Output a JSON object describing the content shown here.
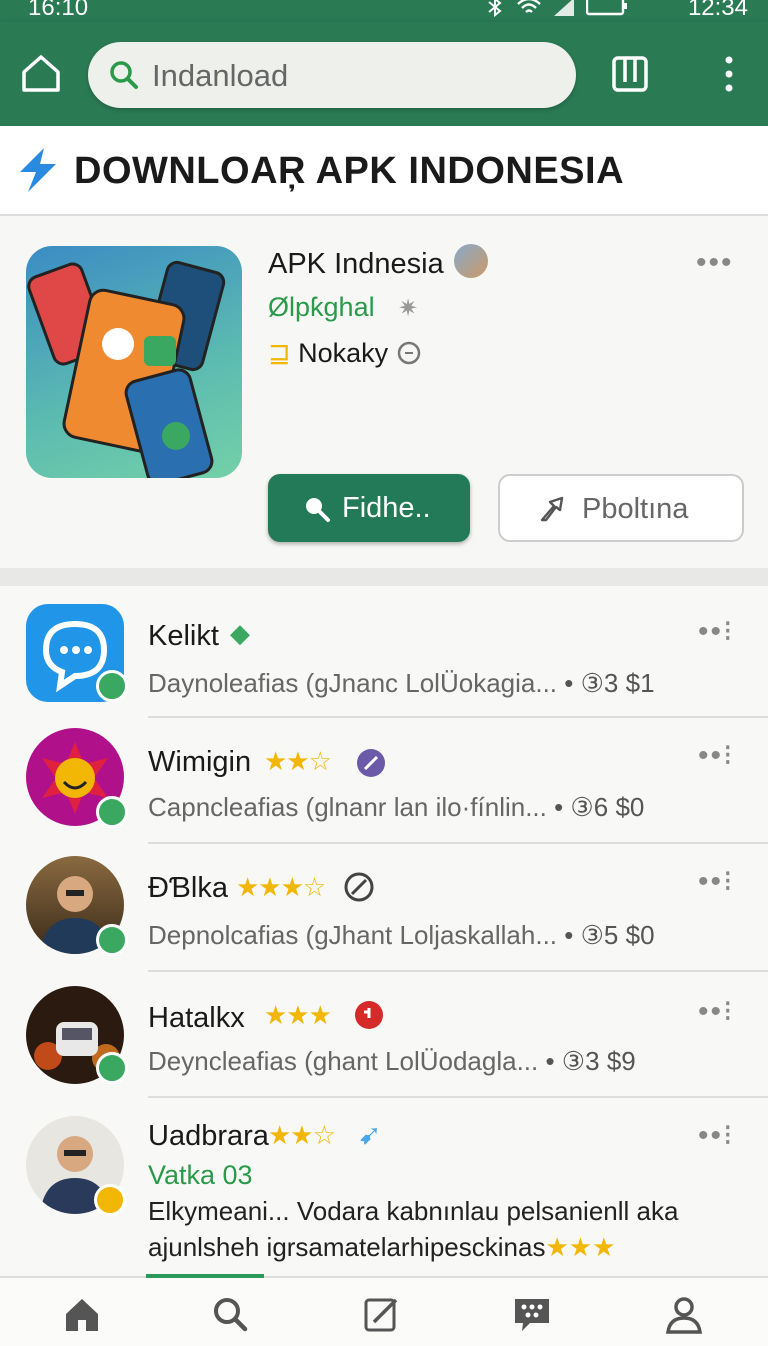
{
  "status": {
    "time_left": "16:10",
    "time_right": "12:34"
  },
  "search": {
    "text": "Indanload"
  },
  "header": {
    "title": "DOWNLOAŖ APK INDONESIA"
  },
  "featured": {
    "name": "APK Indnesia",
    "subtitle": "lpƙghal",
    "developer": "Nokaky",
    "primary_button": "Fidhe..",
    "secondary_button": "Pboltına"
  },
  "items": [
    {
      "name": "Kelikt",
      "desc": "Daynoleafias (ɡJnanc LolÜokagia...",
      "count": "3",
      "price": "$1"
    },
    {
      "name": "Wimigin",
      "desc": "Capncleafias (ɡlnanr lan ilo·fínlin...",
      "count": "6",
      "price": "$0"
    },
    {
      "name": "ƉƁlka",
      "desc": "Depnolcafias (ɡJhant Loljaskallah...",
      "count": "5",
      "price": "$0"
    },
    {
      "name": "Hatalkx",
      "desc": "Deyncleafias (ɡhant LolÜodagla...",
      "count": "3",
      "price": "$9"
    },
    {
      "name": "Uadbrara",
      "sub": "Vatka 03",
      "desc1": "Elkymeani... Vodara kabnınlau pelsanienll aka",
      "desc2": "ajunlsheh igrsamatelarhipesckinas"
    }
  ],
  "colors": {
    "brand": "#2a7a54",
    "accent_green": "#2a9a4a",
    "star": "#f2b705"
  }
}
